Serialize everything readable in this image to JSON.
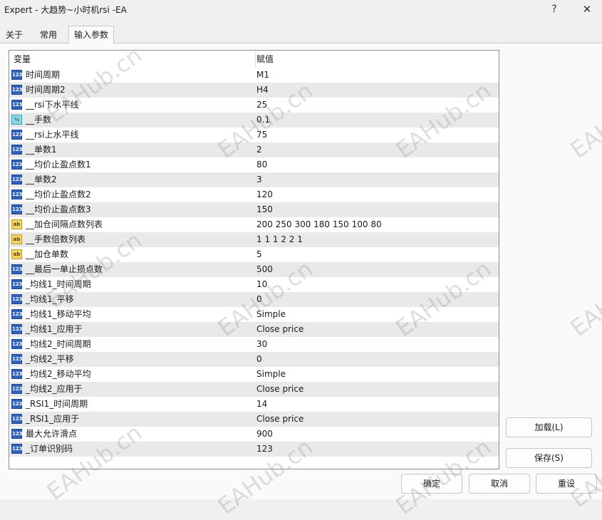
{
  "window": {
    "title": "Expert - 大趋势~小时机rsi -EA",
    "help_glyph": "?",
    "close_glyph": "✕"
  },
  "tabs": [
    {
      "label": "关于",
      "active": false
    },
    {
      "label": "常用",
      "active": false
    },
    {
      "label": "输入参数",
      "active": true
    }
  ],
  "grid": {
    "headers": {
      "variable": "变量",
      "value": "赋值"
    },
    "rows": [
      {
        "icon": "123",
        "type": "int",
        "name": "时间周期",
        "value": "M1"
      },
      {
        "icon": "123",
        "type": "int",
        "name": "时间周期2",
        "value": "H4"
      },
      {
        "icon": "123",
        "type": "int",
        "name": "__rsi下水平线",
        "value": "25"
      },
      {
        "icon": "½",
        "type": "double",
        "name": "__手数",
        "value": "0.1"
      },
      {
        "icon": "123",
        "type": "int",
        "name": "__rsi上水平线",
        "value": "75"
      },
      {
        "icon": "123",
        "type": "int",
        "name": "__单数1",
        "value": "2"
      },
      {
        "icon": "123",
        "type": "int",
        "name": "__均价止盈点数1",
        "value": "80"
      },
      {
        "icon": "123",
        "type": "int",
        "name": "__单数2",
        "value": "3"
      },
      {
        "icon": "123",
        "type": "int",
        "name": "__均价止盈点数2",
        "value": "120"
      },
      {
        "icon": "123",
        "type": "int",
        "name": "__均价止盈点数3",
        "value": "150"
      },
      {
        "icon": "ab",
        "type": "string",
        "name": "__加仓间隔点数列表",
        "value": "200 250 300 180 150 100 80"
      },
      {
        "icon": "ab",
        "type": "string",
        "name": "__手数倍数列表",
        "value": "1 1 1 2 2 1"
      },
      {
        "icon": "ab",
        "type": "string",
        "name": "__加仓单数",
        "value": "5"
      },
      {
        "icon": "123",
        "type": "int",
        "name": "__最后一单止损点数",
        "value": "500"
      },
      {
        "icon": "123",
        "type": "int",
        "name": "_均线1_时间周期",
        "value": "10"
      },
      {
        "icon": "123",
        "type": "int",
        "name": "_均线1_平移",
        "value": "0"
      },
      {
        "icon": "123",
        "type": "int",
        "name": "_均线1_移动平均",
        "value": "Simple"
      },
      {
        "icon": "123",
        "type": "int",
        "name": "_均线1_应用于",
        "value": "Close price"
      },
      {
        "icon": "123",
        "type": "int",
        "name": "_均线2_时间周期",
        "value": "30"
      },
      {
        "icon": "123",
        "type": "int",
        "name": "_均线2_平移",
        "value": "0"
      },
      {
        "icon": "123",
        "type": "int",
        "name": "_均线2_移动平均",
        "value": "Simple"
      },
      {
        "icon": "123",
        "type": "int",
        "name": "_均线2_应用于",
        "value": "Close price"
      },
      {
        "icon": "123",
        "type": "int",
        "name": "_RSI1_时间周期",
        "value": "14"
      },
      {
        "icon": "123",
        "type": "int",
        "name": "_RSI1_应用于",
        "value": "Close price"
      },
      {
        "icon": "123",
        "type": "int",
        "name": "最大允许滑点",
        "value": "900"
      },
      {
        "icon": "123",
        "type": "int",
        "name": "_订单识别码",
        "value": "123"
      }
    ]
  },
  "buttons": {
    "load": "加载(L)",
    "save": "保存(S)",
    "ok": "确定",
    "cancel": "取消",
    "reset": "重设"
  },
  "watermark": {
    "text": "EAHub.cn",
    "color": "#969696"
  }
}
